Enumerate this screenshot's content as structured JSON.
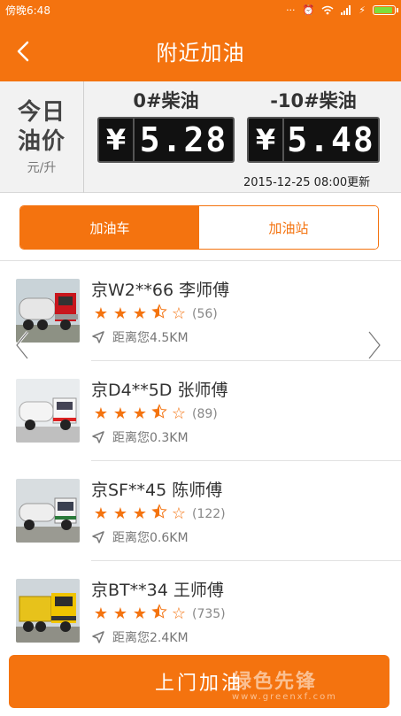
{
  "status_bar": {
    "time": "傍晚6:48",
    "icons": [
      "more-dots-icon",
      "alarm-icon",
      "wifi-icon",
      "signal-icon",
      "charging-icon",
      "battery-icon"
    ],
    "battery_level": 0.95
  },
  "nav": {
    "title": "附近加油",
    "back_icon": "chevron-left-icon"
  },
  "price_panel": {
    "today_line1": "今日",
    "today_line2": "油价",
    "unit": "元/升",
    "fuels": [
      {
        "name": "0#柴油",
        "currency": "¥",
        "price": "5.28"
      },
      {
        "name": "-10#柴油",
        "currency": "¥",
        "price": "5.48"
      }
    ],
    "updated": "2015-12-25 08:00更新"
  },
  "tabs": [
    {
      "label": "加油车",
      "active": true
    },
    {
      "label": "加油站",
      "active": false
    }
  ],
  "trucks": [
    {
      "plate": "京W2**66 李师傅",
      "rating": 3.5,
      "reviews": "(56)",
      "distance": "距离您4.5KM"
    },
    {
      "plate": "京D4**5D 张师傅",
      "rating": 3.5,
      "reviews": "(89)",
      "distance": "距离您0.3KM"
    },
    {
      "plate": "京SF**45 陈师傅",
      "rating": 3.5,
      "reviews": "(122)",
      "distance": "距离您0.6KM"
    },
    {
      "plate": "京BT**34 王师傅",
      "rating": 3.5,
      "reviews": "(735)",
      "distance": "距离您2.4KM"
    }
  ],
  "cta": {
    "label": "上门加油"
  },
  "watermark": {
    "line1": "绿色先锋",
    "line2": "www.greenxf.com"
  },
  "colors": {
    "accent": "#f4730f",
    "price_board": "#111111",
    "panel": "#f2f2f2"
  }
}
